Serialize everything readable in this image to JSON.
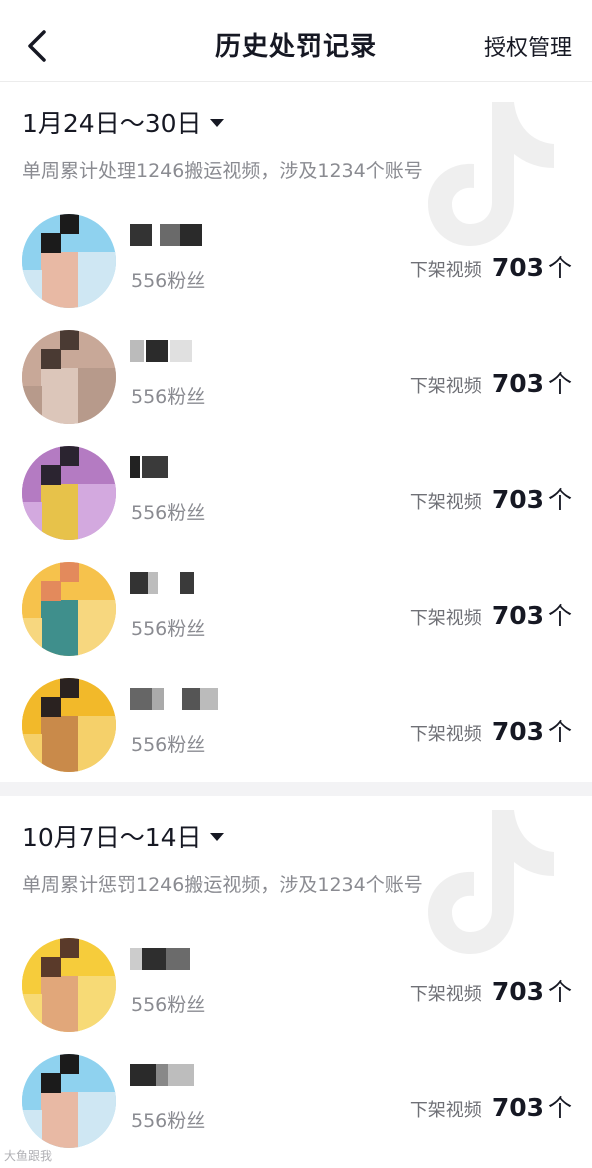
{
  "header": {
    "title": "历史处罚记录",
    "auth_label": "授权管理"
  },
  "sections": [
    {
      "date_range": "1月24日～30日",
      "summary": "单周累计处理1246搬运视频，涉及1234个账号",
      "rows": [
        {
          "fans": "556粉丝",
          "removed_label": "下架视频",
          "removed_count": "703",
          "removed_unit": "个",
          "avatar_colors": [
            "#8fd2ef",
            "#1b1b1b",
            "#e8b9a4",
            "#cfe7f3"
          ]
        },
        {
          "fans": "556粉丝",
          "removed_label": "下架视频",
          "removed_count": "703",
          "removed_unit": "个",
          "avatar_colors": [
            "#c8a898",
            "#4a3a33",
            "#dcc6ba",
            "#b79a8b"
          ]
        },
        {
          "fans": "556粉丝",
          "removed_label": "下架视频",
          "removed_count": "703",
          "removed_unit": "个",
          "avatar_colors": [
            "#b47bc2",
            "#2b2430",
            "#e7c24a",
            "#d3a9df"
          ]
        },
        {
          "fans": "556粉丝",
          "removed_label": "下架视频",
          "removed_count": "703",
          "removed_unit": "个",
          "avatar_colors": [
            "#f6c24c",
            "#e38a5c",
            "#3f8f8c",
            "#f7d77f"
          ]
        },
        {
          "fans": "556粉丝",
          "removed_label": "下架视频",
          "removed_count": "703",
          "removed_unit": "个",
          "avatar_colors": [
            "#f2b92a",
            "#2a2220",
            "#c98a4a",
            "#f5d06a"
          ]
        }
      ]
    },
    {
      "date_range": "10月7日～14日",
      "summary": "单周累计惩罚1246搬运视频，涉及1234个账号",
      "rows": [
        {
          "fans": "556粉丝",
          "removed_label": "下架视频",
          "removed_count": "703",
          "removed_unit": "个",
          "avatar_colors": [
            "#f6cc3b",
            "#5a3a2a",
            "#e1a77a",
            "#f7da76"
          ]
        },
        {
          "fans": "556粉丝",
          "removed_label": "下架视频",
          "removed_count": "703",
          "removed_unit": "个",
          "avatar_colors": [
            "#8fd2ef",
            "#1b1b1b",
            "#e8b9a4",
            "#cfe7f3"
          ]
        }
      ]
    }
  ],
  "footer": {
    "watermark_text": "大鱼跟我"
  }
}
